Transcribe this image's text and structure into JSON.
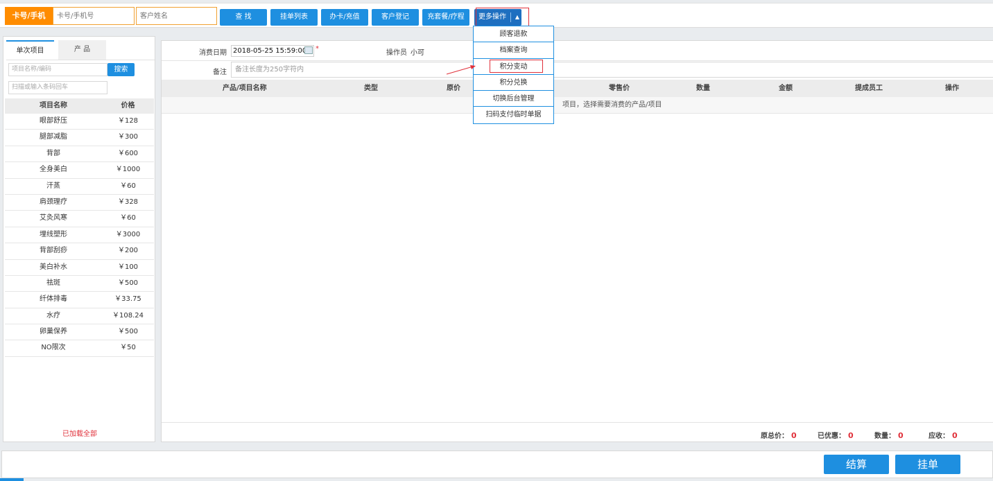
{
  "header": {
    "card_label": "卡号/手机",
    "card_placeholder": "卡号/手机号",
    "name_placeholder": "客户姓名",
    "buttons": [
      "查 找",
      "挂单列表",
      "办卡/充值",
      "客户登记",
      "充套餐/疗程"
    ],
    "more_label": "更多操作"
  },
  "more_menu": [
    "顾客退款",
    "档案查询",
    "积分变动",
    "积分兑换",
    "切换后台管理",
    "扫码支付临时单据"
  ],
  "left_tabs": {
    "active": "单次项目",
    "inactive": "产 品"
  },
  "left_search": {
    "placeholder": "项目名称/编码",
    "button": "搜索",
    "scan_placeholder": "扫描或输入条码回车"
  },
  "items_header": {
    "name": "项目名称",
    "price": "价格"
  },
  "items": [
    {
      "name": "眼部舒压",
      "price": "￥128"
    },
    {
      "name": "腿部减脂",
      "price": "￥300"
    },
    {
      "name": "背部",
      "price": "￥600"
    },
    {
      "name": "全身美白",
      "price": "￥1000"
    },
    {
      "name": "汗蒸",
      "price": "￥60"
    },
    {
      "name": "肩颈理疗",
      "price": "￥328"
    },
    {
      "name": "艾灸风寒",
      "price": "￥60"
    },
    {
      "name": "埋线塑形",
      "price": "￥3000"
    },
    {
      "name": "背部刮痧",
      "price": "￥200"
    },
    {
      "name": "美白补水",
      "price": "￥100"
    },
    {
      "name": "祛斑",
      "price": "￥500"
    },
    {
      "name": "纤体排毒",
      "price": "￥33.75"
    },
    {
      "name": "水疗",
      "price": "￥108.24"
    },
    {
      "name": "卵巢保养",
      "price": "￥500"
    },
    {
      "name": "NO限次",
      "price": "￥50"
    }
  ],
  "left_footer": "已加载全部",
  "form": {
    "date_label": "消费日期",
    "date_value": "2018-05-25 15:59:00",
    "required_mark": "*",
    "operator_label": "操作员",
    "operator_value": "小可",
    "remark_label": "备注",
    "remark_placeholder": "备注长度为250字符内"
  },
  "table_headers": [
    "产品/项目名称",
    "类型",
    "原价",
    "零售价",
    "数量",
    "金额",
    "提成员工",
    "操作"
  ],
  "empty_hint": "项目，选择需要消费的产品/项目",
  "totals": [
    {
      "label": "原总价：",
      "value": "0"
    },
    {
      "label": "已优惠：",
      "value": "0"
    },
    {
      "label": "数量：",
      "value": "0"
    },
    {
      "label": "应收：",
      "value": "0"
    }
  ],
  "footer_buttons": {
    "checkout": "结算",
    "hold": "挂单"
  },
  "colors": {
    "accent": "#1e8fe0",
    "orange": "#ff8c00",
    "red": "#e0303a"
  }
}
